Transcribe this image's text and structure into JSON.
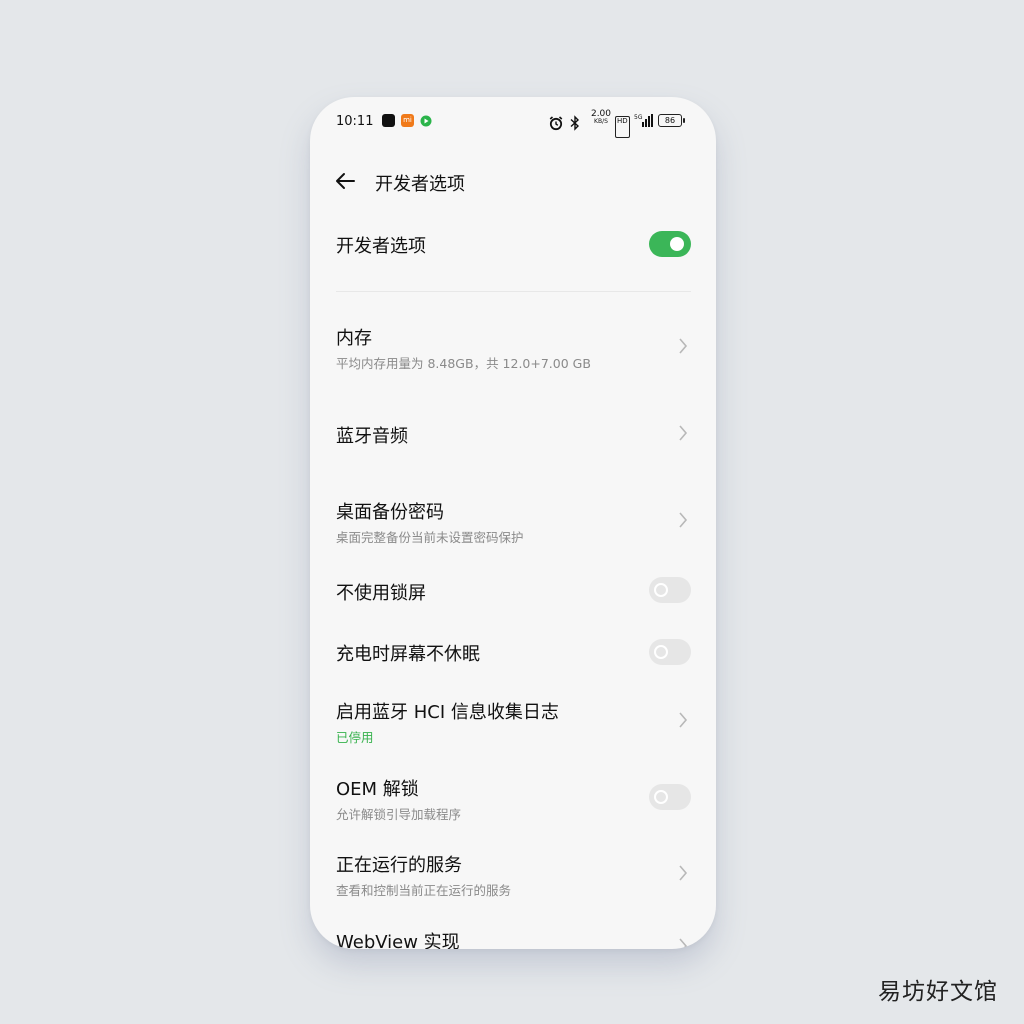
{
  "status_bar": {
    "time": "10:11",
    "mi_label": "mi",
    "speed_value": "2.00",
    "speed_unit": "KB/S",
    "hd": "HD",
    "battery": "86"
  },
  "header": {
    "title": "开发者选项"
  },
  "settings": {
    "developer_options": {
      "label": "开发者选项",
      "enabled": true
    },
    "memory": {
      "label": "内存",
      "subtitle": "平均内存用量为 8.48GB，共 12.0+7.00 GB"
    },
    "bluetooth_audio": {
      "label": "蓝牙音频"
    },
    "desktop_backup_password": {
      "label": "桌面备份密码",
      "subtitle": "桌面完整备份当前未设置密码保护"
    },
    "no_lock_screen": {
      "label": "不使用锁屏",
      "enabled": false
    },
    "stay_awake": {
      "label": "充电时屏幕不休眠",
      "enabled": false
    },
    "bt_hci_log": {
      "label": "启用蓝牙 HCI 信息收集日志",
      "subtitle": "已停用"
    },
    "oem_unlock": {
      "label": "OEM 解锁",
      "subtitle": "允许解锁引导加载程序",
      "enabled": false
    },
    "running_services": {
      "label": "正在运行的服务",
      "subtitle": "查看和控制当前正在运行的服务"
    },
    "webview": {
      "label": "WebView 实现"
    }
  },
  "colors": {
    "toggle_on": "#3bb658",
    "status_green": "#37b24d",
    "background": "#e4e7ea"
  },
  "watermark": "易坊好文馆"
}
